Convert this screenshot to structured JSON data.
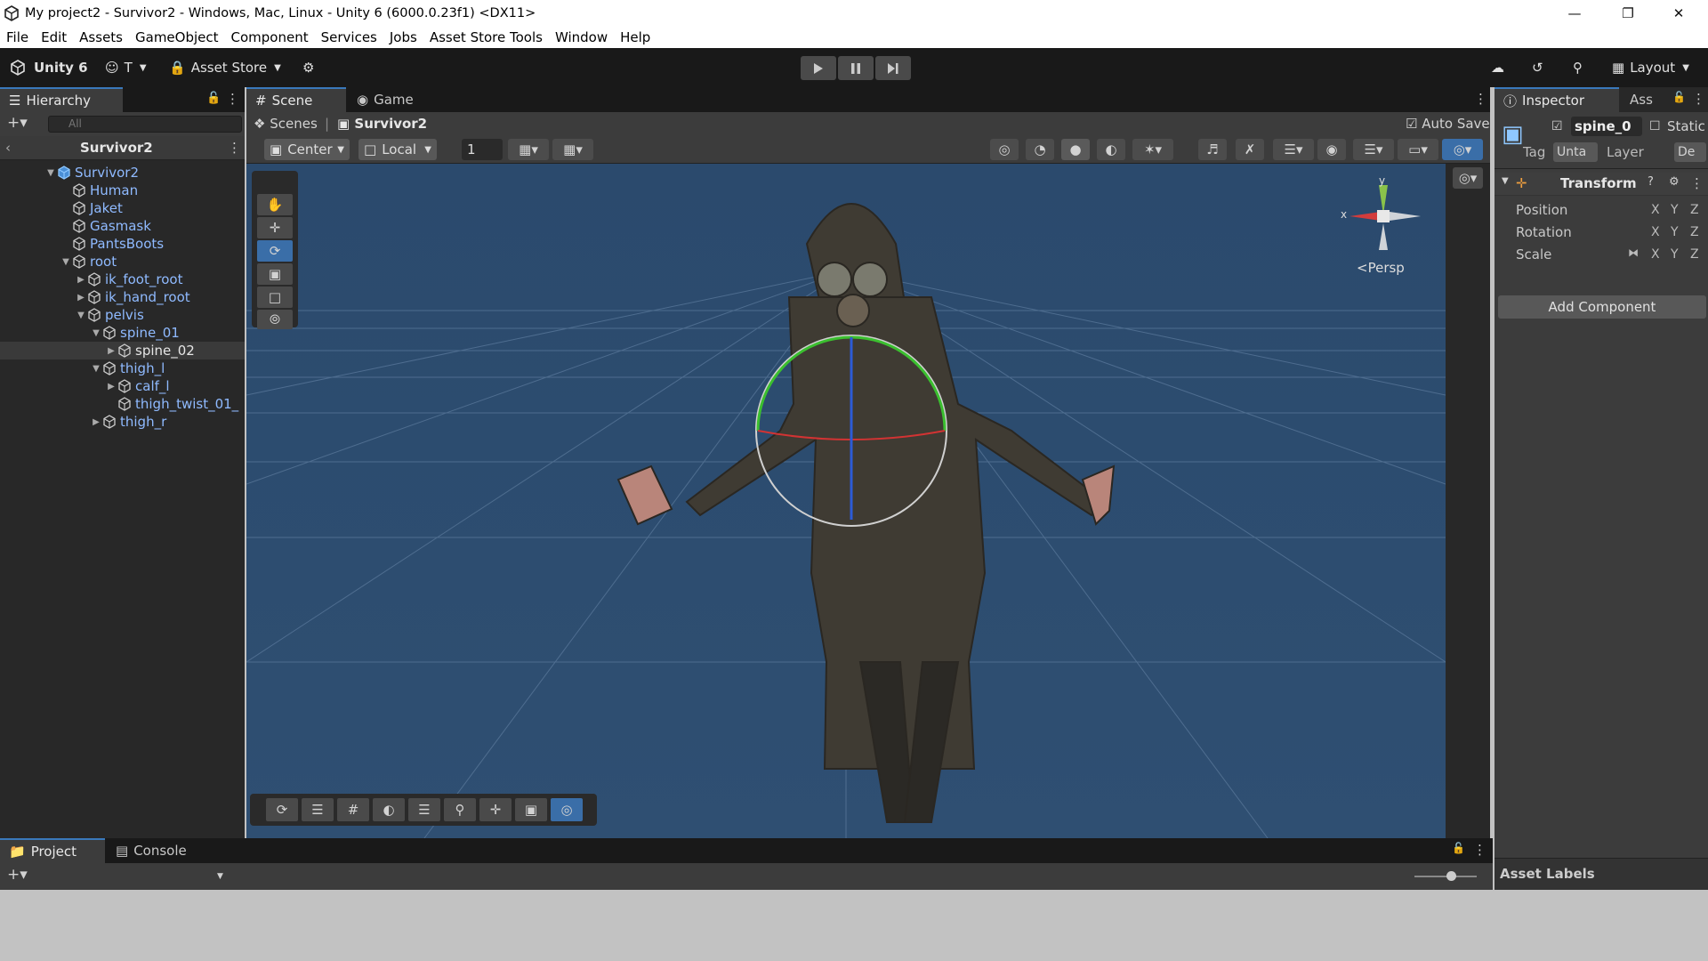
{
  "window": {
    "title": "My project2 - Survivor2 - Windows, Mac, Linux - Unity 6 (6000.0.23f1) <DX11>"
  },
  "menu": [
    "File",
    "Edit",
    "Assets",
    "GameObject",
    "Component",
    "Services",
    "Jobs",
    "Asset Store Tools",
    "Window",
    "Help"
  ],
  "toolbar": {
    "brand": "Unity 6",
    "account": "T",
    "asset_store": "Asset Store",
    "layout": "Layout"
  },
  "hierarchy": {
    "tab": "Hierarchy",
    "search_placeholder": "All",
    "scene_name": "Survivor2",
    "items": [
      {
        "label": "Survivor2",
        "depth": 0
      },
      {
        "label": "Human",
        "depth": 1
      },
      {
        "label": "Jaket",
        "depth": 1
      },
      {
        "label": "Gasmask",
        "depth": 1
      },
      {
        "label": "PantsBoots",
        "depth": 1
      },
      {
        "label": "root",
        "depth": 1
      },
      {
        "label": "ik_foot_root",
        "depth": 2
      },
      {
        "label": "ik_hand_root",
        "depth": 2
      },
      {
        "label": "pelvis",
        "depth": 2
      },
      {
        "label": "spine_01",
        "depth": 3
      },
      {
        "label": "spine_02",
        "depth": 4
      },
      {
        "label": "thigh_l",
        "depth": 3
      },
      {
        "label": "calf_l",
        "depth": 4
      },
      {
        "label": "thigh_twist_01_",
        "depth": 4
      },
      {
        "label": "thigh_r",
        "depth": 3
      }
    ]
  },
  "scene": {
    "tabs": [
      "Scene",
      "Game"
    ],
    "breadcrumb": [
      "Scenes",
      "Survivor2"
    ],
    "auto_save": "Auto Save",
    "pivot_mode": "Center",
    "pivot_rotation": "Local",
    "grid_size": "1",
    "gizmo": {
      "y": "y",
      "x": "x",
      "projection": "Persp"
    }
  },
  "inspector": {
    "tabs": [
      "Inspector",
      "Ass"
    ],
    "object_name": "spine_0",
    "static": "Static",
    "tag_label": "Tag",
    "tag_value": "Unta",
    "layer_label": "Layer",
    "layer_value": "De",
    "component": "Transform",
    "fields": [
      "Position",
      "Rotation",
      "Scale"
    ],
    "axes": [
      "X",
      "Y",
      "Z"
    ],
    "add_component": "Add Component",
    "asset_labels": "Asset Labels"
  },
  "bottom": {
    "tabs": [
      "Project",
      "Console"
    ]
  },
  "colors": {
    "accent": "#3a79bb",
    "link": "#8fbaff",
    "scene_sky": "#2c4c6f"
  }
}
